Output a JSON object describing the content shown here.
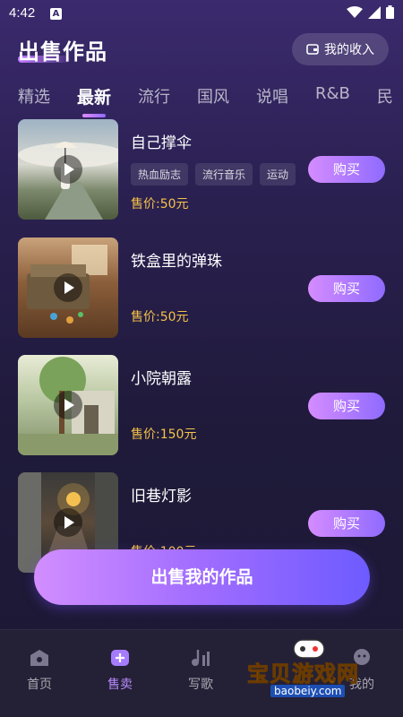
{
  "status": {
    "time": "4:42"
  },
  "header": {
    "title": "出售作品",
    "income_label": "我的收入"
  },
  "tabs": [
    "精选",
    "最新",
    "流行",
    "国风",
    "说唱",
    "R&B",
    "民"
  ],
  "items": [
    {
      "title": "自己撑伞",
      "tags": [
        "热血励志",
        "流行音乐",
        "运动"
      ],
      "price": "售价:50元",
      "buy_label": "购买"
    },
    {
      "title": "铁盒里的弹珠",
      "tags": [],
      "price": "售价:50元",
      "buy_label": "购买"
    },
    {
      "title": "小院朝露",
      "tags": [],
      "price": "售价:150元",
      "buy_label": "购买"
    },
    {
      "title": "旧巷灯影",
      "tags": [],
      "price": "售价:100元",
      "buy_label": "购买"
    }
  ],
  "sell_button": "出售我的作品",
  "nav": [
    {
      "label": "首页"
    },
    {
      "label": "售卖"
    },
    {
      "label": "写歌"
    },
    {
      "label": "我的"
    }
  ],
  "watermark": {
    "text": "宝贝游戏网",
    "url": "baobeiy.com"
  },
  "colors": {
    "accent": "#a06cff",
    "price": "#f5c24a",
    "active_nav": "#b88bff"
  }
}
